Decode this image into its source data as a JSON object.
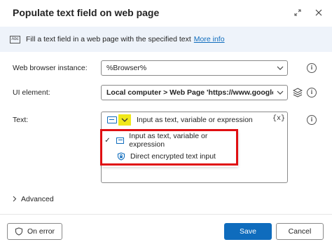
{
  "dialog": {
    "title": "Populate text field on web page",
    "expand_icon": "expand-icon",
    "close_icon": "close-icon"
  },
  "info": {
    "icon": "text-field-doc-icon",
    "icon_text": "Abc",
    "description": "Fill a text field in a web page with the specified text",
    "more_info": "More info"
  },
  "fields": {
    "browser": {
      "label": "Web browser instance:",
      "value": "%Browser%"
    },
    "ui_element": {
      "label": "UI element:",
      "value": "Local computer > Web Page 'https://www.google.com/' >"
    },
    "text": {
      "label": "Text:",
      "placeholder": "Input as text, variable or expression",
      "variable_button": "{x}"
    }
  },
  "dropdown": {
    "options": [
      {
        "label": "Input as text, variable or expression",
        "selected": true
      },
      {
        "label": "Direct encrypted text input",
        "selected": false
      }
    ]
  },
  "advanced": {
    "label": "Advanced"
  },
  "footer": {
    "on_error": "On error",
    "save": "Save",
    "cancel": "Cancel"
  },
  "colors": {
    "accent": "#0f6cbd",
    "highlight": "#f0e81a",
    "annotation_red": "#e00f12",
    "banner_bg": "#eef3fa"
  }
}
